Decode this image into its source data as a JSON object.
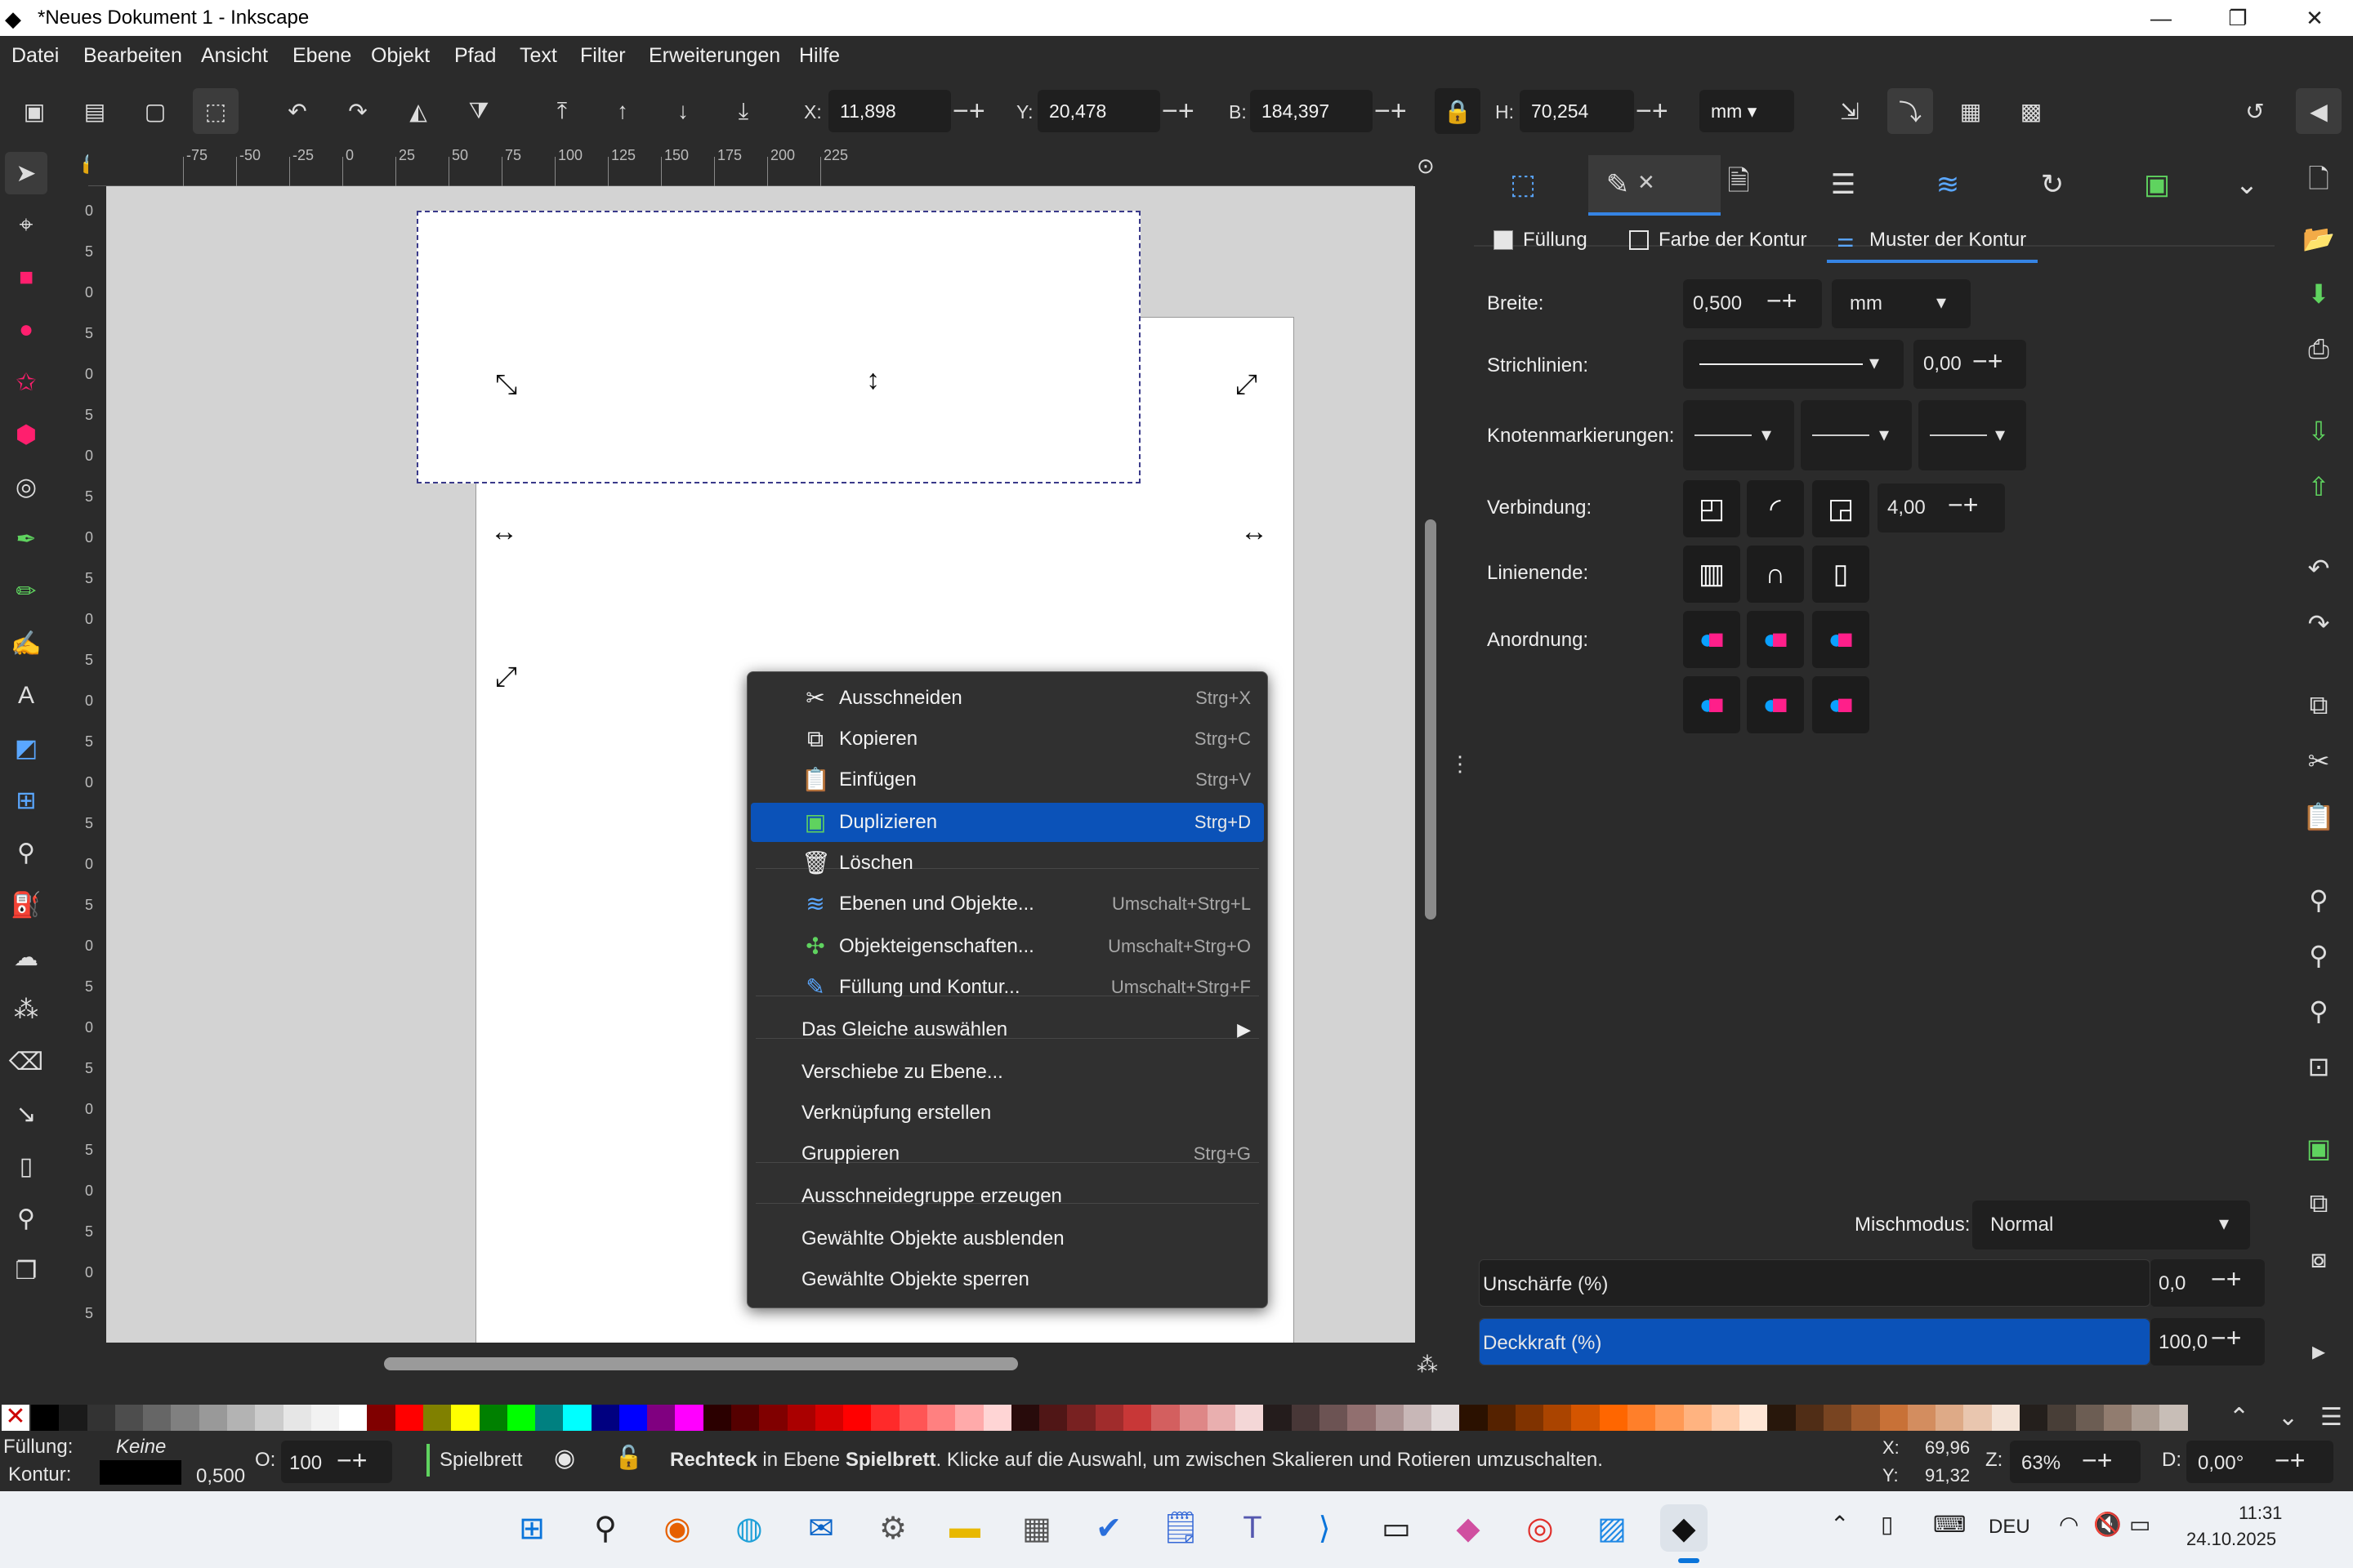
{
  "window": {
    "title": "*Neues Dokument 1 - Inkscape",
    "minimize": "—",
    "maximize": "❐",
    "close": "✕"
  },
  "menu": [
    "Datei",
    "Bearbeiten",
    "Ansicht",
    "Ebene",
    "Objekt",
    "Pfad",
    "Text",
    "Filter",
    "Erweiterungen",
    "Hilfe"
  ],
  "toolbar": {
    "x_label": "X:",
    "x": "11,898",
    "y_label": "Y:",
    "y": "20,478",
    "w_label": "B:",
    "w": "184,397",
    "h_label": "H:",
    "h": "70,254",
    "unit": "mm"
  },
  "ruler_h": [
    "-75",
    "-50",
    "-25",
    "0",
    "25",
    "50",
    "75",
    "100",
    "125",
    "150",
    "175",
    "200",
    "225"
  ],
  "ruler_v": [
    "0",
    "5",
    "0",
    "5",
    "0",
    "5",
    "0",
    "5",
    "0",
    "5",
    "0",
    "5",
    "0",
    "5",
    "0",
    "5",
    "0",
    "5",
    "0",
    "5",
    "0",
    "5",
    "0",
    "5",
    "0",
    "5",
    "0",
    "5"
  ],
  "context_menu": [
    {
      "icon": "scissors-icon",
      "glyph": "✂",
      "label": "Ausschneiden",
      "shortcut": "Strg+X"
    },
    {
      "icon": "copy-icon",
      "glyph": "⧉",
      "label": "Kopieren",
      "shortcut": "Strg+C"
    },
    {
      "icon": "paste-icon",
      "glyph": "📋",
      "label": "Einfügen",
      "shortcut": "Strg+V"
    },
    {
      "icon": "duplicate-icon",
      "glyph": "▣",
      "label": "Duplizieren",
      "shortcut": "Strg+D"
    },
    {
      "icon": "trash-icon",
      "glyph": "🗑",
      "label": "Löschen",
      "shortcut": ""
    },
    {
      "icon": "layers-icon",
      "glyph": "≋",
      "label": "Ebenen und Objekte...",
      "shortcut": "Umschalt+Strg+L"
    },
    {
      "icon": "object-properties-icon",
      "glyph": "✣",
      "label": "Objekteigenschaften...",
      "shortcut": "Umschalt+Strg+O"
    },
    {
      "icon": "fill-stroke-icon",
      "glyph": "✎",
      "label": "Füllung und Kontur...",
      "shortcut": "Umschalt+Strg+F"
    },
    {
      "icon": "",
      "glyph": "",
      "label": "Das Gleiche auswählen",
      "shortcut": "▶"
    },
    {
      "icon": "",
      "glyph": "",
      "label": "Verschiebe zu Ebene...",
      "shortcut": ""
    },
    {
      "icon": "",
      "glyph": "",
      "label": "Verknüpfung erstellen",
      "shortcut": ""
    },
    {
      "icon": "",
      "glyph": "",
      "label": "Gruppieren",
      "shortcut": "Strg+G"
    },
    {
      "icon": "",
      "glyph": "",
      "label": "Ausschneidegruppe erzeugen",
      "shortcut": ""
    },
    {
      "icon": "",
      "glyph": "",
      "label": "Gewählte Objekte ausblenden",
      "shortcut": ""
    },
    {
      "icon": "",
      "glyph": "",
      "label": "Gewählte Objekte sperren",
      "shortcut": ""
    }
  ],
  "fill_stroke": {
    "subtabs": [
      "Füllung",
      "Farbe der Kontur",
      "Muster der Kontur"
    ],
    "breite_label": "Breite:",
    "breite": "0,500",
    "breite_unit": "mm",
    "strich_label": "Strichlinien:",
    "strich_offset": "0,00",
    "knoten_label": "Knotenmarkierungen:",
    "verbindung_label": "Verbindung:",
    "verbindung_val": "4,00",
    "linienende_label": "Linienende:",
    "anordnung_label": "Anordnung:",
    "mischmodus_label": "Mischmodus:",
    "mischmodus": "Normal",
    "unschaerfe_label": "Unschärfe (%)",
    "unschaerfe": "0,0",
    "deckkraft_label": "Deckkraft (%)",
    "deckkraft": "100,0"
  },
  "status": {
    "fuellung_label": "Füllung:",
    "fuellung": "Keine",
    "kontur_label": "Kontur:",
    "kontur_width": "0,500",
    "o_label": "O:",
    "o_val": "100",
    "layer": "Spielbrett",
    "msg_obj": "Rechteck",
    "msg_mid": " in Ebene ",
    "msg_layer": "Spielbrett",
    "msg_end": ". Klicke auf die Auswahl, um zwischen Skalieren und Rotieren umzuschalten.",
    "x_label": "X:",
    "x": "69,96",
    "y_label": "Y:",
    "y": "91,32",
    "z_label": "Z:",
    "zoom": "63%",
    "d_label": "D:",
    "rot": "0,00°"
  },
  "palette": [
    "#000000",
    "#1a1a1a",
    "#333333",
    "#4d4d4d",
    "#666666",
    "#808080",
    "#999999",
    "#b3b3b3",
    "#cccccc",
    "#e6e6e6",
    "#f2f2f2",
    "#ffffff",
    "#800000",
    "#ff0000",
    "#808000",
    "#ffff00",
    "#008000",
    "#00ff00",
    "#008080",
    "#00ffff",
    "#000080",
    "#0000ff",
    "#800080",
    "#ff00ff",
    "#2b0000",
    "#550000",
    "#800000",
    "#aa0000",
    "#d40000",
    "#ff0000",
    "#ff2a2a",
    "#ff5555",
    "#ff8080",
    "#ffaaaa",
    "#ffd5d5",
    "#280b0b",
    "#501616",
    "#782121",
    "#a02c2c",
    "#c83737",
    "#d35f5f",
    "#de8787",
    "#e9afaf",
    "#f4d7d7",
    "#241c1c",
    "#483737",
    "#6c5353",
    "#916f6f",
    "#ac9393",
    "#c8b7b7",
    "#e3dbdb",
    "#2b1100",
    "#552200",
    "#803300",
    "#aa4400",
    "#d45500",
    "#ff6600",
    "#ff7f2a",
    "#ff9955",
    "#ffb380",
    "#ffccaa",
    "#ffe6d5",
    "#28170b",
    "#502d16",
    "#784421",
    "#a05a2c",
    "#c87137",
    "#d38d5f",
    "#deaa87",
    "#e9c6af",
    "#f4e3d7",
    "#241f1c",
    "#483e37",
    "#6c5d53",
    "#917c6f",
    "#ac9d93",
    "#c8beb7"
  ],
  "taskbar": {
    "time": "11:31",
    "date": "24.10.2025",
    "lang": "DEU"
  },
  "colors": {
    "accent": "#0b52b8",
    "panel": "#2b2b2b"
  }
}
